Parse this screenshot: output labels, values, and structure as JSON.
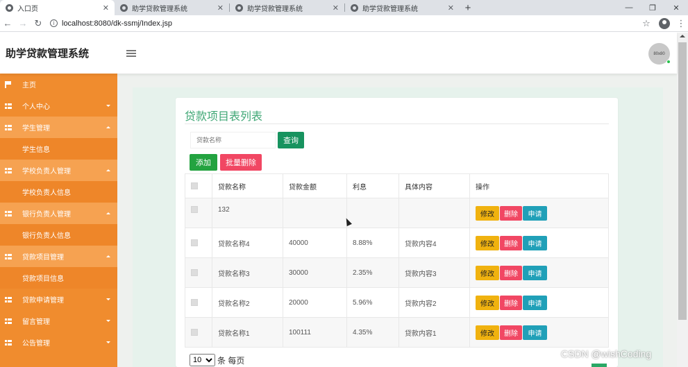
{
  "browser": {
    "tabs": [
      {
        "title": "入口页",
        "active": true
      },
      {
        "title": "助学贷款管理系统",
        "active": false
      },
      {
        "title": "助学贷款管理系统",
        "active": false
      },
      {
        "title": "助学贷款管理系统",
        "active": false
      }
    ],
    "close_glyph": "✕",
    "new_tab_glyph": "+",
    "url": "localhost:8080/dk-ssmj/Index.jsp",
    "window_controls": [
      "—",
      "❐",
      "✕"
    ]
  },
  "header": {
    "title": "助学贷款管理系统",
    "avatar_text": "80x80"
  },
  "sidebar": {
    "items": [
      {
        "label": "主页",
        "icon": "flag-icon",
        "type": "top",
        "caret": ""
      },
      {
        "label": "个人中心",
        "icon": "grid-icon",
        "type": "top",
        "caret": "down"
      },
      {
        "label": "学生管理",
        "icon": "grid-icon",
        "type": "top",
        "caret": "up",
        "active": true
      },
      {
        "label": "学生信息",
        "type": "sub"
      },
      {
        "label": "学校负责人管理",
        "icon": "grid-icon",
        "type": "top",
        "caret": "up",
        "active": true
      },
      {
        "label": "学校负责人信息",
        "type": "sub"
      },
      {
        "label": "银行负责人管理",
        "icon": "grid-icon",
        "type": "top",
        "caret": "up",
        "active": true
      },
      {
        "label": "银行负责人信息",
        "type": "sub"
      },
      {
        "label": "贷款项目管理",
        "icon": "grid-icon",
        "type": "top",
        "caret": "up",
        "active": true
      },
      {
        "label": "贷款项目信息",
        "type": "sub"
      },
      {
        "label": "贷款申请管理",
        "icon": "grid-icon",
        "type": "top",
        "caret": "down"
      },
      {
        "label": "留言管理",
        "icon": "grid-icon",
        "type": "top",
        "caret": "down"
      },
      {
        "label": "公告管理",
        "icon": "grid-icon",
        "type": "top",
        "caret": "down"
      }
    ]
  },
  "main": {
    "card_title": "贷款项目表列表",
    "search": {
      "placeholder": "贷款名称",
      "value": ""
    },
    "buttons": {
      "query": "查询",
      "add": "添加",
      "batch_delete": "批量删除"
    },
    "table": {
      "headers": [
        "",
        "贷款名称",
        "贷款金额",
        "利息",
        "具体内容",
        "操作"
      ],
      "rows": [
        {
          "name": "132",
          "amount": "",
          "interest": "",
          "content": ""
        },
        {
          "name": "贷款名称4",
          "amount": "40000",
          "interest": "8.88%",
          "content": "贷款内容4"
        },
        {
          "name": "贷款名称3",
          "amount": "30000",
          "interest": "2.35%",
          "content": "贷款内容3"
        },
        {
          "name": "贷款名称2",
          "amount": "20000",
          "interest": "5.96%",
          "content": "贷款内容2"
        },
        {
          "name": "贷款名称1",
          "amount": "100111",
          "interest": "4.35%",
          "content": "贷款内容1"
        }
      ],
      "row_actions": {
        "edit": "修改",
        "delete": "删除",
        "apply": "申请"
      }
    },
    "pager": {
      "page_size": "10",
      "page_size_options": [
        "10"
      ],
      "suffix": "条 每页"
    }
  },
  "watermark": "CSDN @wishCoding",
  "colors": {
    "sidebar": "#f08c2e",
    "title_green": "#3fa775",
    "query_btn": "#17935f",
    "add_btn": "#23a340",
    "delete_btn": "#f14763",
    "edit_btn": "#f0b20f",
    "apply_btn": "#20a0b8"
  }
}
